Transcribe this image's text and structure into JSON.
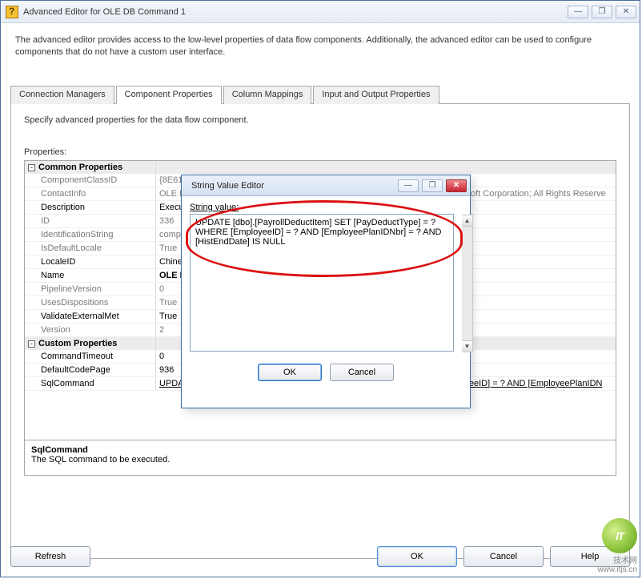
{
  "window": {
    "title": "Advanced Editor for OLE DB Command 1",
    "minimize": "—",
    "maximize": "❐",
    "close": "✕"
  },
  "description": "The advanced editor provides access to the low-level properties of data flow components. Additionally, the advanced editor can be used to configure components that do not have a custom user interface.",
  "tabs": {
    "items": [
      "Connection Managers",
      "Component Properties",
      "Column Mappings",
      "Input and Output Properties"
    ],
    "activeIndex": 1
  },
  "page": {
    "instruction": "Specify advanced properties for the data flow component.",
    "propertiesLabel": "Properties:"
  },
  "grid": {
    "cat1": "Common Properties",
    "cat2": "Custom Properties",
    "rows": [
      {
        "name": "ComponentClassID",
        "value": "{8E61C8",
        "gray": true
      },
      {
        "name": "ContactInfo",
        "value": "OLE DB",
        "valueFull": "oft Corporation; All Rights Reserve",
        "gray": true
      },
      {
        "name": "Description",
        "value": "Executes",
        "bold": true
      },
      {
        "name": "ID",
        "value": "336",
        "gray": true
      },
      {
        "name": "IdentificationString",
        "value": "compon",
        "gray": true
      },
      {
        "name": "IsDefaultLocale",
        "value": "True",
        "gray": true
      },
      {
        "name": "LocaleID",
        "value": "Chinese",
        "bold": true
      },
      {
        "name": "Name",
        "value": "OLE DB",
        "bold": true,
        "heavy": true
      },
      {
        "name": "PipelineVersion",
        "value": "0",
        "gray": true
      },
      {
        "name": "UsesDispositions",
        "value": "True",
        "gray": true
      },
      {
        "name": "ValidateExternalMet",
        "value": "True",
        "bold": true
      },
      {
        "name": "Version",
        "value": "2",
        "gray": true
      }
    ],
    "custom": [
      {
        "name": "CommandTimeout",
        "value": "0"
      },
      {
        "name": "DefaultCodePage",
        "value": "936"
      },
      {
        "name": "SqlCommand",
        "value": "UPDATE [dbo].[PayrollDeductItem] SET [PayDeductType] = ? WHERE [EmployeeID] = ? AND [EmployeePlanIDN"
      }
    ],
    "descTitle": "SqlCommand",
    "descText": "The SQL command to be executed."
  },
  "buttons": {
    "refresh": "Refresh",
    "ok": "OK",
    "cancel": "Cancel",
    "help": "Help"
  },
  "modal": {
    "title": "String Value Editor",
    "label": "String value:",
    "text": "UPDATE [dbo].[PayrollDeductItem] SET [PayDeductType] = ? WHERE [EmployeeID] = ? AND [EmployeePlanIDNbr] = ? AND [HistEndDate] IS NULL",
    "ok": "OK",
    "cancel": "Cancel",
    "minimize": "—",
    "maximize": "❐",
    "close": "✕"
  },
  "watermark": {
    "logo": "IT",
    "tag": "技术网",
    "url": "www.itjs.cn"
  }
}
